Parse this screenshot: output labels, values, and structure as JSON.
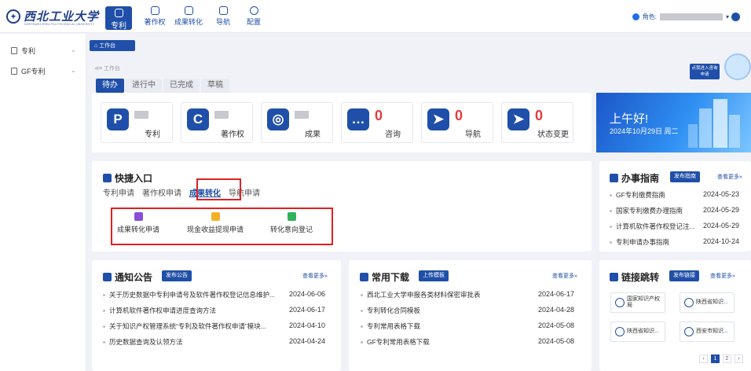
{
  "header": {
    "logo_text": "西北工业大学",
    "logo_sub": "NORTHWESTERN POLYTECHNICAL UNIVERSITY",
    "nav": [
      {
        "label": "专利",
        "icon": "document-icon",
        "active": true
      },
      {
        "label": "著作权",
        "icon": "chart-icon"
      },
      {
        "label": "成果转化",
        "icon": "document-icon"
      },
      {
        "label": "导航",
        "icon": "document-icon"
      },
      {
        "label": "配置",
        "icon": "gear-icon"
      }
    ],
    "role_label": "角色:"
  },
  "sidebar": {
    "items": [
      {
        "label": "专利",
        "icon": "document-icon"
      },
      {
        "label": "GF专利",
        "icon": "document-icon"
      }
    ]
  },
  "workbench_tab": "工作台",
  "breadcrumb": "工作台",
  "status_tabs": [
    "待办",
    "进行中",
    "已完成",
    "草稿"
  ],
  "stat_cards": [
    {
      "icon_letter": "P",
      "label": "专利",
      "value": ""
    },
    {
      "icon_letter": "C",
      "label": "著作权",
      "value": ""
    },
    {
      "icon_letter": "◎",
      "label": "成果",
      "value": ""
    },
    {
      "icon_letter": "…",
      "label": "咨询",
      "value": "0"
    },
    {
      "icon_letter": "➤",
      "label": "导航",
      "value": "0"
    },
    {
      "icon_letter": "➤",
      "label": "状态变更",
      "value": "0"
    }
  ],
  "greeting": {
    "title": "上午好!",
    "date": "2024年10月29日 周二",
    "banner_btn": "点我进入咨询申请"
  },
  "quick": {
    "title": "快捷入口",
    "tabs": [
      "专利申请",
      "著作权申请",
      "成果转化",
      "导航申请"
    ],
    "active_tab": 2,
    "items": [
      {
        "label": "成果转化申请",
        "color": "#8a4fd8"
      },
      {
        "label": "现金收益提现申请",
        "color": "#f2b12a"
      },
      {
        "label": "转化意向登记",
        "color": "#2fb35a"
      }
    ]
  },
  "guide": {
    "title": "办事指南",
    "button": "发布指南",
    "more": "查看更多»",
    "rows": [
      {
        "text": "GF专利缴费指南",
        "date": "2024-05-23"
      },
      {
        "text": "国家专利缴费办理指南",
        "date": "2024-05-29"
      },
      {
        "text": "计算机软件著作权登记注...",
        "date": "2024-05-29"
      },
      {
        "text": "专利申请办事指南",
        "date": "2024-10-24"
      }
    ]
  },
  "notice": {
    "title": "通知公告",
    "button": "发布公告",
    "more": "查看更多»",
    "rows": [
      {
        "text": "关于历史数据中专利申请号及软件著作权登记信息维护...",
        "date": "2024-06-06"
      },
      {
        "text": "计算机软件著作权申请进度查询方法",
        "date": "2024-06-17"
      },
      {
        "text": "关于知识产权管理系统“专利及软件著作权申请”模块...",
        "date": "2024-04-10"
      },
      {
        "text": "历史数据查询及认领方法",
        "date": "2024-04-24"
      }
    ]
  },
  "downloads": {
    "title": "常用下载",
    "button": "上传模板",
    "more": "查看更多»",
    "rows": [
      {
        "text": "西北工业大学申报各类材料保密审批表",
        "date": "2024-06-17"
      },
      {
        "text": "专利转化合同模板",
        "date": "2024-04-28"
      },
      {
        "text": "专利常用表格下载",
        "date": "2024-05-08"
      },
      {
        "text": "GF专利常用表格下载",
        "date": "2024-05-08"
      }
    ]
  },
  "links": {
    "title": "链接跳转",
    "button": "发布链接",
    "more": "查看更多»",
    "items": [
      "国家知识产权局",
      "陕西省知识...",
      "陕西省知识...",
      "西安市知识..."
    ],
    "pager": [
      "‹",
      "1",
      "2",
      "›"
    ]
  }
}
